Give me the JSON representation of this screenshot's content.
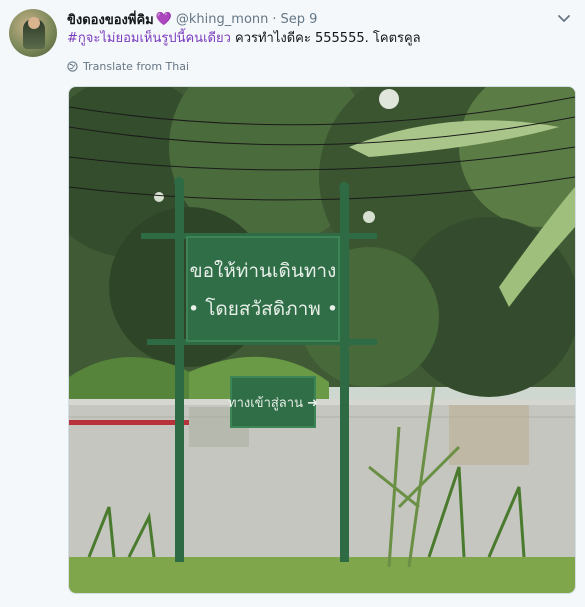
{
  "tweet": {
    "display_name": "ขิงดองของพี่คิม",
    "name_emoji": "💜",
    "handle": "@khing_monn",
    "date": "Sep 9",
    "hashtag": "#กูจะไม่ยอมเห็นรูปนี้คนเดียว",
    "body": " ควรทำไงดีคะ 555555. โคตรคูล",
    "translate_label": "Translate from Thai"
  },
  "photo": {
    "sign_main_line1": "ขอให้ท่านเดินทาง",
    "sign_main_line2": "• โดยสวัสดิภาพ •",
    "sign_small": "ทางเข้าสู่ลาน ➜"
  },
  "colors": {
    "hashtag": "#7a3cbf",
    "muted": "#657786",
    "sign_green": "#2e6b45"
  }
}
